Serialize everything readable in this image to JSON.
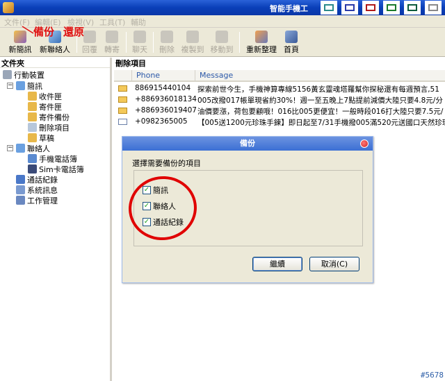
{
  "window": {
    "title": "智能手機工"
  },
  "menu": [
    "文件(F)",
    "編輯(E)",
    "檢視(V)",
    "工具(T)",
    "輔助"
  ],
  "toolbar": {
    "buttons": [
      {
        "label": "新簡訊",
        "enabled": true,
        "icon": "new-sms-icon"
      },
      {
        "label": "新聯絡人",
        "enabled": true,
        "icon": "new-contact-icon"
      },
      {
        "label": "回覆",
        "enabled": false,
        "icon": "reply-icon"
      },
      {
        "label": "轉寄",
        "enabled": false,
        "icon": "forward-icon"
      },
      {
        "label": "聊天",
        "enabled": false,
        "icon": "chat-icon"
      },
      {
        "label": "刪除",
        "enabled": false,
        "icon": "delete-icon"
      },
      {
        "label": "複製到",
        "enabled": false,
        "icon": "copy-to-icon"
      },
      {
        "label": "移動到",
        "enabled": false,
        "icon": "move-to-icon"
      },
      {
        "label": "重新整理",
        "enabled": true,
        "icon": "refresh-icon"
      },
      {
        "label": "首頁",
        "enabled": true,
        "icon": "home-icon"
      }
    ],
    "annotation_backup": "備份",
    "annotation_restore": "還原"
  },
  "folder_panel": {
    "title": "文件夾",
    "items": [
      {
        "label": "行動裝置",
        "icon": "device-icon"
      },
      {
        "label": "簡訊",
        "icon": "sms-folder-icon"
      },
      {
        "label": "收件匣",
        "icon": "inbox-icon"
      },
      {
        "label": "寄件匣",
        "icon": "outbox-icon"
      },
      {
        "label": "寄件備份",
        "icon": "sent-icon"
      },
      {
        "label": "刪除項目",
        "icon": "deleted-icon"
      },
      {
        "label": "草稿",
        "icon": "draft-icon"
      },
      {
        "label": "聯絡人",
        "icon": "contacts-folder-icon"
      },
      {
        "label": "手機電話簿",
        "icon": "phone-book-icon"
      },
      {
        "label": "Sim卡電話簿",
        "icon": "sim-book-icon"
      },
      {
        "label": "通話紀錄",
        "icon": "call-log-icon"
      },
      {
        "label": "系統訊息",
        "icon": "system-message-icon"
      },
      {
        "label": "工作管理",
        "icon": "task-manager-icon"
      }
    ]
  },
  "message_panel": {
    "title": "刪除項目",
    "columns": [
      "Phone",
      "Message"
    ],
    "rows": [
      {
        "phone": "886915440104",
        "message": "探索前世今生，手機神算專線5156黃玄靈魂塔羅幫你探秘還有每週預言,51",
        "read": false
      },
      {
        "phone": "+886936018134",
        "message": "005改撥017帳單現省約30%！週一至五晚上7點提前減價大陸只要4.8元/分",
        "read": false
      },
      {
        "phone": "+886936019407",
        "message": "油價要漲，荷包要顧哦！016比005更便宜！一般時段016打大陸只要7.5元/",
        "read": false
      },
      {
        "phone": "+0982365005",
        "message": "【005送1200元珍珠手鍊】即日起至7/31手機撥005滿520元送國口天然珍珠",
        "read": true
      }
    ]
  },
  "dialog": {
    "title": "備份",
    "prompt": "選擇需要備份的項目",
    "options": [
      {
        "label": "簡訊",
        "checked": true
      },
      {
        "label": "聯絡人",
        "checked": true
      },
      {
        "label": "通話紀錄",
        "checked": true
      }
    ],
    "continue_label": "繼續",
    "cancel_label": "取消(C)"
  },
  "watermark": "#5678"
}
